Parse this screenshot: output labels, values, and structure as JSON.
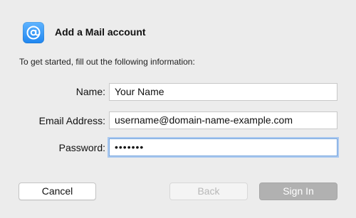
{
  "dialog": {
    "title": "Add a Mail account",
    "intro": "To get started, fill out the following information:",
    "app_icon": "mail-at-icon"
  },
  "form": {
    "name": {
      "label": "Name:",
      "value": "Your Name"
    },
    "email": {
      "label": "Email Address:",
      "value": "username@domain-name-example.com"
    },
    "password": {
      "label": "Password:",
      "value": "•••••••"
    }
  },
  "buttons": {
    "cancel": "Cancel",
    "back": "Back",
    "sign_in": "Sign In"
  },
  "colors": {
    "accent": "#2a8cf2",
    "focus_ring": "#a9c8f0",
    "window_bg": "#ececec"
  }
}
